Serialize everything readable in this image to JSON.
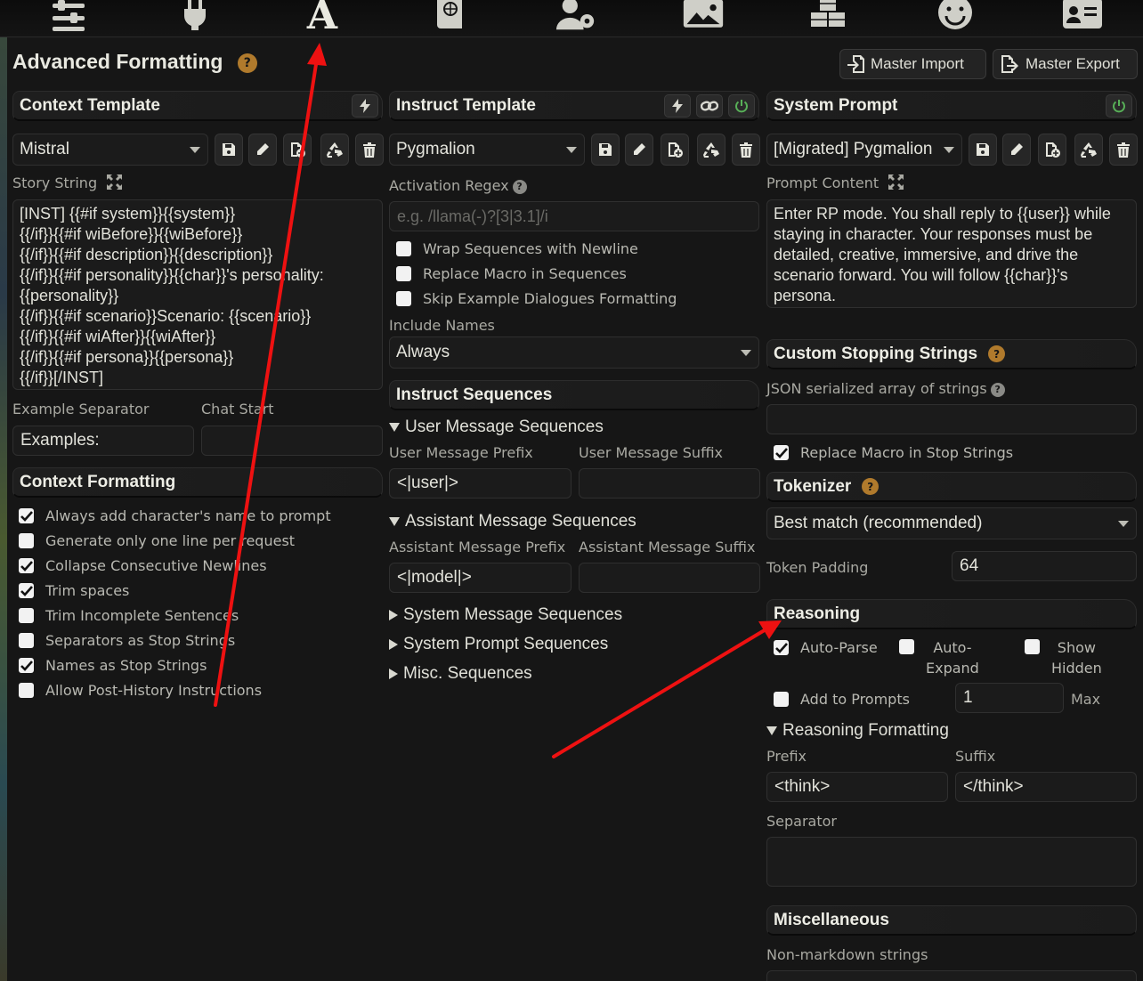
{
  "page": {
    "title": "Advanced Formatting"
  },
  "top_icons": [
    "sliders-icon",
    "plug-icon",
    "font-a-icon",
    "book-globe-icon",
    "user-gear-icon",
    "image-icon",
    "cubes-icon",
    "smile-icon",
    "id-card-icon"
  ],
  "header": {
    "master_import": "Master Import",
    "master_export": "Master Export"
  },
  "context_template": {
    "title": "Context Template",
    "selected": "Mistral",
    "story_string_label": "Story String",
    "story_string": "[INST] {{#if system}}{{system}}\n{{/if}}{{#if wiBefore}}{{wiBefore}}\n{{/if}}{{#if description}}{{description}}\n{{/if}}{{#if personality}}{{char}}'s personality: {{personality}}\n{{/if}}{{#if scenario}}Scenario: {{scenario}}\n{{/if}}{{#if wiAfter}}{{wiAfter}}\n{{/if}}{{#if persona}}{{persona}}\n{{/if}}[/INST]",
    "example_separator_label": "Example Separator",
    "example_separator": "Examples:",
    "chat_start_label": "Chat Start",
    "chat_start": ""
  },
  "context_formatting": {
    "title": "Context Formatting",
    "options": [
      {
        "label": "Always add character's name to prompt",
        "checked": true
      },
      {
        "label": "Generate only one line per request",
        "checked": false
      },
      {
        "label": "Collapse Consecutive Newlines",
        "checked": true
      },
      {
        "label": "Trim spaces",
        "checked": true
      },
      {
        "label": "Trim Incomplete Sentences",
        "checked": false
      },
      {
        "label": "Separators as Stop Strings",
        "checked": false
      },
      {
        "label": "Names as Stop Strings",
        "checked": true
      },
      {
        "label": "Allow Post-History Instructions",
        "checked": false
      }
    ]
  },
  "instruct_template": {
    "title": "Instruct Template",
    "selected": "Pygmalion",
    "activation_regex_label": "Activation Regex",
    "activation_regex_placeholder": "e.g. /llama(-)?[3|3.1]/i",
    "options": [
      {
        "label": "Wrap Sequences with Newline",
        "checked": false
      },
      {
        "label": "Replace Macro in Sequences",
        "checked": false
      },
      {
        "label": "Skip Example Dialogues Formatting",
        "checked": false
      }
    ],
    "include_names_label": "Include Names",
    "include_names": "Always"
  },
  "instruct_sequences": {
    "title": "Instruct Sequences",
    "user_group": "User Message Sequences",
    "user_prefix_label": "User Message Prefix",
    "user_suffix_label": "User Message Suffix",
    "user_prefix": "<|user|>",
    "user_suffix": "",
    "assistant_group": "Assistant Message Sequences",
    "assistant_prefix_label": "Assistant Message Prefix",
    "assistant_suffix_label": "Assistant Message Suffix",
    "assistant_prefix": "<|model|>",
    "assistant_suffix": "",
    "collapsed": [
      "System Message Sequences",
      "System Prompt Sequences",
      "Misc. Sequences"
    ]
  },
  "system_prompt": {
    "title": "System Prompt",
    "selected": "[Migrated] Pygmalion",
    "content_label": "Prompt Content",
    "content": "Enter RP mode. You shall reply to {{user}} while staying in character. Your responses must be detailed, creative, immersive, and drive the scenario forward. You will follow {{char}}'s persona."
  },
  "stopping_strings": {
    "title": "Custom Stopping Strings",
    "json_label": "JSON serialized array of strings",
    "value": "",
    "replace_macro_label": "Replace Macro in Stop Strings",
    "replace_macro_checked": true
  },
  "tokenizer": {
    "title": "Tokenizer",
    "selected": "Best match (recommended)",
    "padding_label": "Token Padding",
    "padding": "64"
  },
  "reasoning": {
    "title": "Reasoning",
    "auto_parse": "Auto-Parse",
    "auto_expand": "Auto-\nExpand",
    "show_hidden": "Show\nHidden",
    "add_to_prompts": "Add to Prompts",
    "max_value": "1",
    "max_label": "Max",
    "formatting_label": "Reasoning Formatting",
    "prefix_label": "Prefix",
    "suffix_label": "Suffix",
    "prefix": "<think>",
    "suffix": "</think>",
    "separator_label": "Separator",
    "separator": ""
  },
  "misc": {
    "title": "Miscellaneous",
    "non_markdown_label": "Non-markdown strings"
  },
  "colors": {
    "accent_help": "#b07a2c",
    "arrow": "#ee1111",
    "power": "#58b058"
  }
}
